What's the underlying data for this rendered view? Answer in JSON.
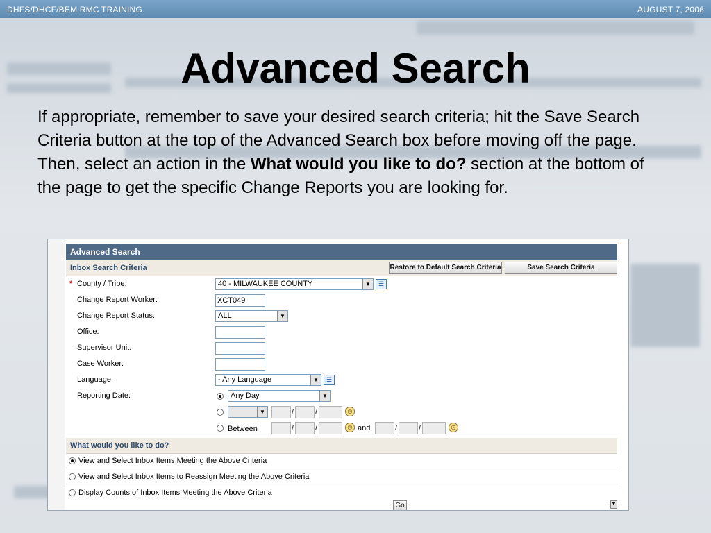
{
  "slide": {
    "header_left": "DHFS/DHCF/BEM  RMC TRAINING",
    "header_right": "AUGUST 7, 2006",
    "title": "Advanced Search",
    "body_part1": "If appropriate, remember to save your desired search criteria; hit the Save Search Criteria button at the top of the Advanced Search box before moving off the page.  Then, select an action in the ",
    "body_bold": "What would you like to do?",
    "body_part2": " section at the bottom of the page to get the specific Change Reports you are looking for."
  },
  "app": {
    "panel_title": "Advanced Search",
    "criteria_title": "Inbox Search Criteria",
    "restore_button": "Restore to Default Search Criteria",
    "save_button": "Save Search Criteria",
    "fields": {
      "county": {
        "label": "County / Tribe:",
        "value": "40 - MILWAUKEE COUNTY",
        "required_mark": "*"
      },
      "worker": {
        "label": "Change Report Worker:",
        "value": "XCT049"
      },
      "status": {
        "label": "Change Report Status:",
        "value": "ALL"
      },
      "office": {
        "label": "Office:",
        "value": ""
      },
      "supervisor": {
        "label": "Supervisor Unit:",
        "value": ""
      },
      "caseworker": {
        "label": "Case Worker:",
        "value": ""
      },
      "language": {
        "label": "Language:",
        "value": "- Any Language"
      },
      "reporting": {
        "label": "Reporting Date:",
        "option1_value": "Any Day",
        "option2_value": "",
        "between_label": "Between",
        "and_label": "and",
        "slash": "/"
      }
    },
    "action_title": "What would you like to do?",
    "actions": [
      {
        "label": "View and Select Inbox Items Meeting the Above Criteria",
        "selected": true
      },
      {
        "label": "View and Select Inbox Items to Reassign Meeting the Above Criteria",
        "selected": false
      },
      {
        "label": "Display Counts of Inbox Items Meeting the Above Criteria",
        "selected": false
      }
    ],
    "go_button": "Go"
  },
  "icons": {
    "dropdown_arrow": "▼",
    "list_picker": "☰",
    "calendar": "◷"
  },
  "colors": {
    "panel_header": "#4e6a87",
    "section_text": "#2c4a6e",
    "required": "#cc0000",
    "slide_bar": "#6a95bb"
  }
}
